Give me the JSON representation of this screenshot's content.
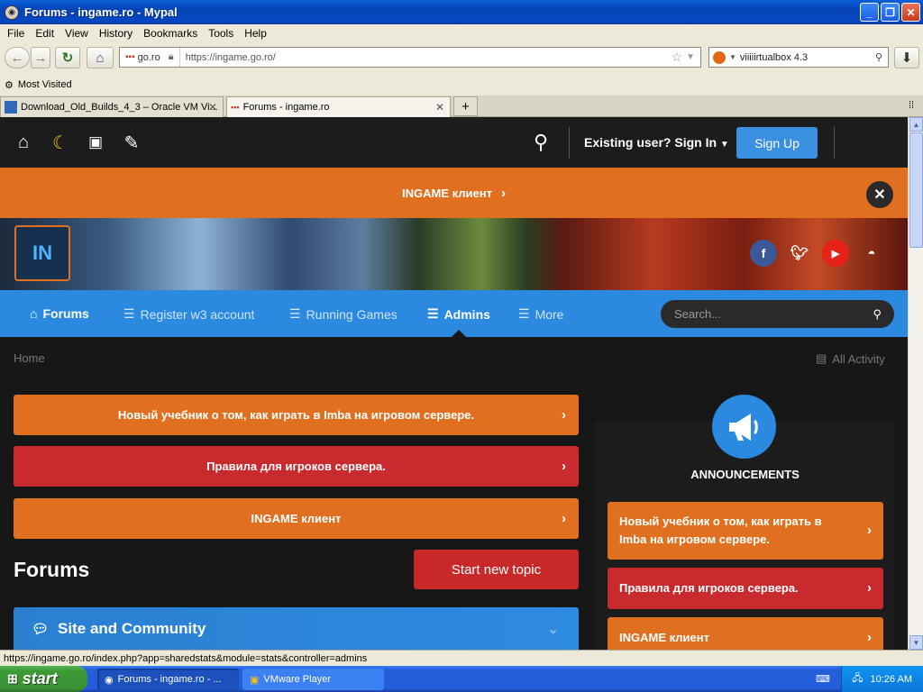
{
  "window": {
    "title": "Forums - ingame.ro - Mypal"
  },
  "menu": [
    "File",
    "Edit",
    "View",
    "History",
    "Bookmarks",
    "Tools",
    "Help"
  ],
  "address": {
    "site": "go.ro",
    "url": "https://ingame.go.ro/"
  },
  "search": {
    "value": "viiiiirtualbox 4.3"
  },
  "bookmarks": {
    "most_visited": "Most Visited"
  },
  "tabs": [
    {
      "label": "Download_Old_Builds_4_3 – Oracle VM Vi..."
    },
    {
      "label": "Forums - ingame.ro"
    }
  ],
  "site": {
    "signin": "Existing user? Sign In",
    "signup": "Sign Up",
    "banner": "INGAME клиент",
    "nav": [
      "Forums",
      "Register w3 account",
      "Running Games",
      "Admins",
      "More"
    ],
    "search_placeholder": "Search...",
    "breadcrumb": "Home",
    "all_activity": "All Activity",
    "announcements_bars": [
      {
        "label": "Новый учебник о том, как играть в Imba на игровом сервере.",
        "color": "#e0701f"
      },
      {
        "label": "Правила для игроков сервера.",
        "color": "#c92a2e"
      },
      {
        "label": "INGAME клиент",
        "color": "#e0701f"
      }
    ],
    "forums_heading": "Forums",
    "start_topic": "Start new topic",
    "category": "Site and Community",
    "sidebar": {
      "heading": "ANNOUNCEMENTS",
      "items": [
        {
          "label": "Новый учебник о том, как играть в Imba на игровом сервере.",
          "color": "#e0701f"
        },
        {
          "label": "Правила для игроков сервера.",
          "color": "#c92a2e"
        },
        {
          "label": "INGAME клиент",
          "color": "#e0701f"
        }
      ]
    }
  },
  "statusbar": {
    "text": "https://ingame.go.ro/index.php?app=sharedstats&module=stats&controller=admins"
  },
  "taskbar": {
    "start": "start",
    "tasks": [
      "Forums - ingame.ro - ...",
      "VMware Player"
    ],
    "time": "10:26 AM"
  }
}
